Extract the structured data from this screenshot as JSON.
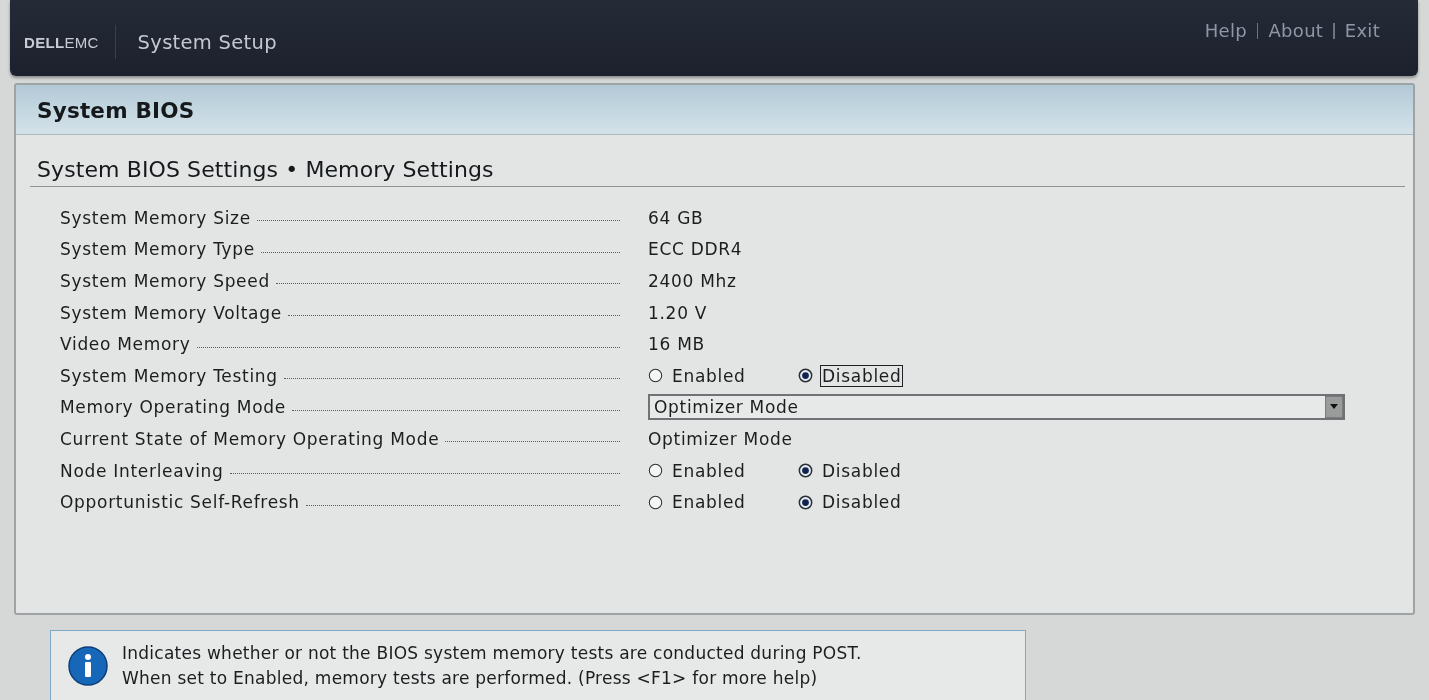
{
  "header": {
    "logo": "**DELL**EMC",
    "title": "System Setup",
    "links": [
      {
        "label": "Help"
      },
      {
        "label": "About"
      },
      {
        "label": "Exit"
      }
    ]
  },
  "panel": {
    "title": "System BIOS",
    "subtitle": "System BIOS Settings • Memory Settings"
  },
  "settings": [
    {
      "kind": "text",
      "label": "System Memory Size",
      "value": "64 GB"
    },
    {
      "kind": "text",
      "label": "System Memory Type",
      "value": "ECC DDR4"
    },
    {
      "kind": "text",
      "label": "System Memory Speed",
      "value": "2400 Mhz"
    },
    {
      "kind": "text",
      "label": "System Memory Voltage",
      "value": "1.20 V"
    },
    {
      "kind": "text",
      "label": "Video Memory",
      "value": "16 MB"
    },
    {
      "kind": "radio",
      "label": "System Memory Testing",
      "options": [
        {
          "label": "Enabled",
          "selected": false,
          "focused": false
        },
        {
          "label": "Disabled",
          "selected": true,
          "focused": true
        }
      ]
    },
    {
      "kind": "dropdown",
      "label": "Memory Operating Mode",
      "value": "Optimizer Mode"
    },
    {
      "kind": "text",
      "label": "Current State of Memory Operating Mode",
      "value": "Optimizer Mode"
    },
    {
      "kind": "radio",
      "label": "Node Interleaving",
      "options": [
        {
          "label": "Enabled",
          "selected": false,
          "focused": false
        },
        {
          "label": "Disabled",
          "selected": true,
          "focused": false
        }
      ]
    },
    {
      "kind": "radio",
      "label": "Opportunistic Self-Refresh",
      "options": [
        {
          "label": "Enabled",
          "selected": false,
          "focused": false
        },
        {
          "label": "Disabled",
          "selected": true,
          "focused": false
        }
      ]
    }
  ],
  "help": {
    "text": "Indicates whether or not the BIOS system memory tests are conducted during POST.\nWhen set to Enabled, memory tests are performed. (Press <F1> for more help)"
  }
}
